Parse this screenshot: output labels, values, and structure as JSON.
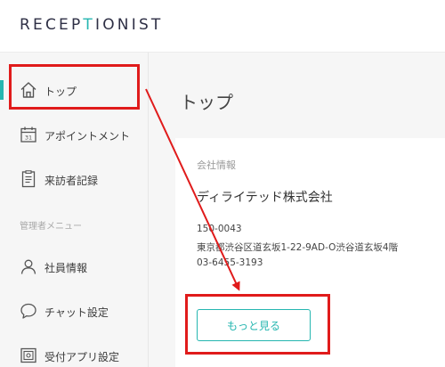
{
  "header": {
    "logo_part1": "RECEP",
    "logo_part2": "T",
    "logo_part3": "IONIST"
  },
  "sidebar": {
    "items": [
      {
        "label": "トップ",
        "icon": "home-icon",
        "active": true
      },
      {
        "label": "アポイントメント",
        "icon": "calendar-icon",
        "active": false
      },
      {
        "label": "来訪者記録",
        "icon": "document-list-icon",
        "active": false
      }
    ],
    "section_label": "管理者メニュー",
    "admin_items": [
      {
        "label": "社員情報",
        "icon": "user-icon",
        "active": false
      },
      {
        "label": "チャット設定",
        "icon": "chat-bubble-icon",
        "active": false
      },
      {
        "label": "受付アプリ設定",
        "icon": "app-settings-icon",
        "active": false
      }
    ]
  },
  "main": {
    "page_title": "トップ",
    "card": {
      "label": "会社情報",
      "company_name": "ディライテッド株式会社",
      "postal_code": "150-0043",
      "address": "東京都渋谷区道玄坂1-22-9AD-O渋谷道玄坂4階",
      "phone": "03-6455-3193",
      "more_button_label": "もっと見る"
    }
  },
  "colors": {
    "accent": "#25b6b0",
    "logo_dark": "#2e2f45",
    "highlight": "#e01b1b",
    "sidebar_bg": "#f6f6f6"
  }
}
